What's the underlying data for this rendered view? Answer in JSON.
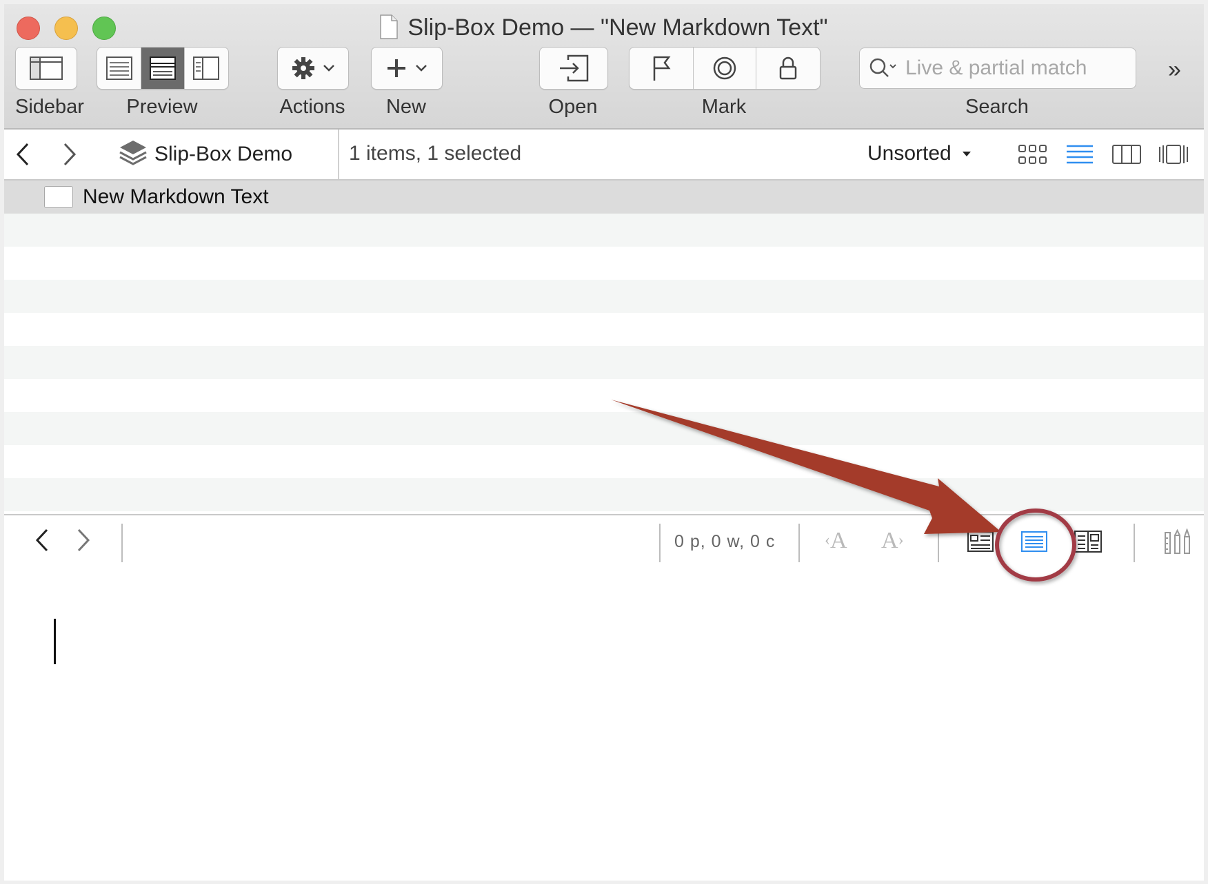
{
  "window": {
    "title": "Slip-Box Demo — \"New Markdown Text\""
  },
  "toolbar": {
    "sidebar_label": "Sidebar",
    "preview_label": "Preview",
    "actions_label": "Actions",
    "new_label": "New",
    "open_label": "Open",
    "mark_label": "Mark",
    "search_label": "Search",
    "search_placeholder": "Live & partial match",
    "overflow": "»"
  },
  "pathbar": {
    "database_name": "Slip-Box Demo",
    "item_count": "1 items, 1 selected",
    "sort_label": "Unsorted"
  },
  "list": {
    "items": [
      {
        "title": "New Markdown Text",
        "selected": true
      }
    ]
  },
  "editorbar": {
    "stats": "0 p, 0 w, 0 c",
    "decrease_font_glyph": "A",
    "increase_font_glyph": "A"
  },
  "colors": {
    "accent_blue": "#2f8ef0",
    "annotation_arrow": "#a43a29",
    "annotation_circle": "#a23b45"
  }
}
